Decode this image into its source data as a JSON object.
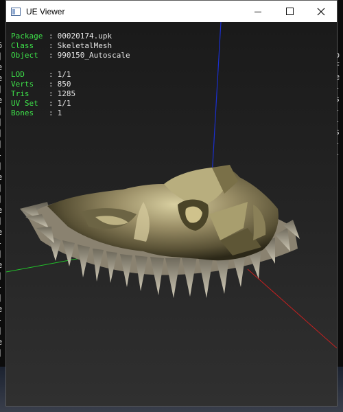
{
  "window": {
    "title": "UE Viewer",
    "controls": {
      "minimize": "minimize",
      "maximize": "maximize",
      "close": "close"
    }
  },
  "info": {
    "object_block": [
      {
        "key": "Package",
        "value": "00020174.upk"
      },
      {
        "key": "Class",
        "value": "SkeletalMesh"
      },
      {
        "key": "Object",
        "value": "990150_Autoscale"
      }
    ],
    "stats_block": [
      {
        "key": "LOD",
        "value": "1/1"
      },
      {
        "key": "Verts",
        "value": "850"
      },
      {
        "key": "Tris",
        "value": "1285"
      },
      {
        "key": "UV Set",
        "value": "1/1"
      },
      {
        "key": "Bones",
        "value": "1"
      }
    ]
  },
  "axes": {
    "x_color": "#c62020",
    "y_color": "#22c22a",
    "z_color": "#1a2fd0"
  },
  "background_console": {
    "left_chars": [
      "6",
      "]",
      "e",
      "e",
      "]",
      "e",
      "]",
      "]",
      "]",
      "]",
      "-",
      "]",
      "e",
      "]",
      "]",
      "e",
      "]",
      "e",
      "-",
      "]",
      "e",
      "]",
      "-",
      "]",
      "e",
      "-",
      "]",
      "e",
      "]"
    ],
    "right_chars": [
      "o",
      "F",
      "e",
      "-",
      "s",
      "-",
      "-",
      "s",
      "-",
      "-"
    ]
  }
}
